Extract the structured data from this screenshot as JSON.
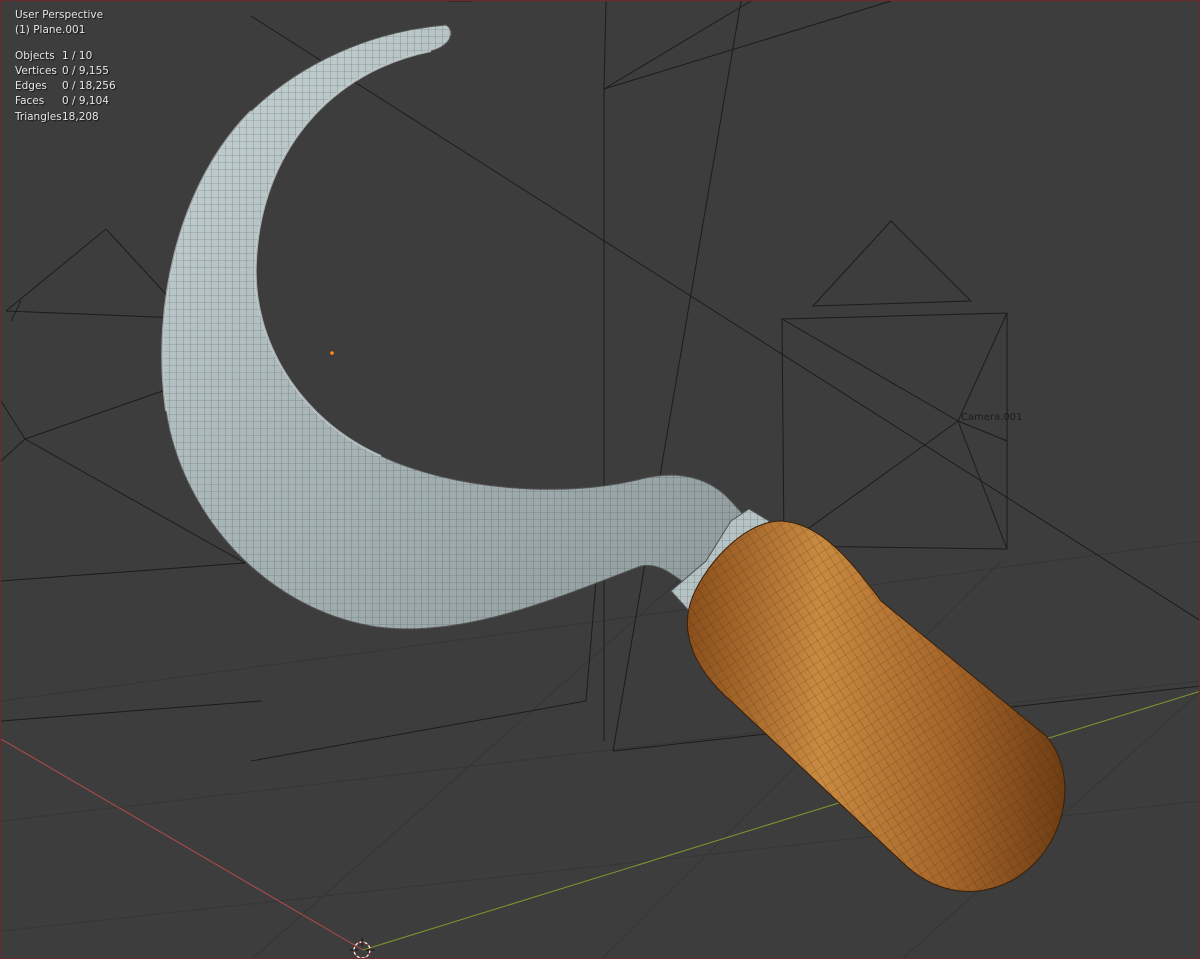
{
  "viewport": {
    "view_name": "User Perspective",
    "active_object": "(1) Plane.001",
    "stats": [
      {
        "label": "Objects",
        "value": "1 / 10"
      },
      {
        "label": "Vertices",
        "value": "0 / 9,155"
      },
      {
        "label": "Edges",
        "value": "0 / 18,256"
      },
      {
        "label": "Faces",
        "value": "0 / 9,104"
      },
      {
        "label": "Triangles",
        "value": "18,208"
      }
    ],
    "camera_label": "Camera.001",
    "colors": {
      "background": "#3d3d3d",
      "blade": "#a9b6b8",
      "handle": "#a8682a",
      "x_axis": "#b44b4b",
      "y_axis": "#7d9a2e",
      "wire": "#1c1c1c"
    }
  }
}
